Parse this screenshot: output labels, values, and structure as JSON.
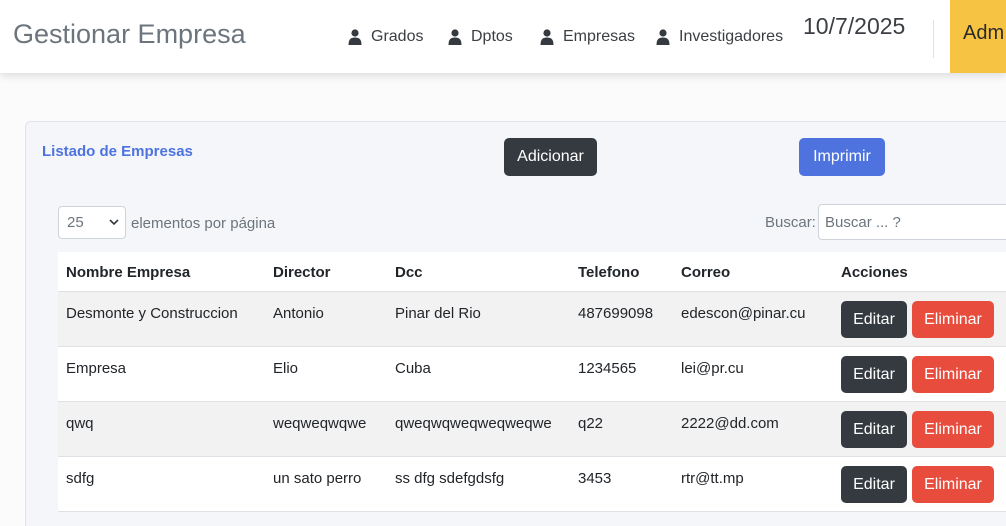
{
  "header": {
    "brand": "Gestionar Empresa",
    "nav": [
      {
        "label": "Grados",
        "icon": "user-icon"
      },
      {
        "label": "Dptos",
        "icon": "user-icon"
      },
      {
        "label": "Empresas",
        "icon": "user-icon"
      },
      {
        "label": "Investigadores",
        "icon": "user-icon"
      }
    ],
    "date": "10/7/2025",
    "admin_label": "Adm"
  },
  "card": {
    "title": "Listado de Empresas",
    "add_label": "Adicionar",
    "print_label": "Imprimir"
  },
  "controls": {
    "page_size": "25",
    "per_page_label": "elementos por página",
    "search_label": "Buscar:",
    "search_placeholder": "Buscar ... ?"
  },
  "table": {
    "headers": [
      "Nombre Empresa",
      "Director",
      "Dcc",
      "Telefono",
      "Correo",
      "Acciones"
    ],
    "rows": [
      [
        "Desmonte y Construccion",
        "Antonio",
        "Pinar del Rio",
        "487699098",
        "edescon@pinar.cu"
      ],
      [
        "Empresa",
        "Elio",
        "Cuba",
        "1234565",
        "lei@pr.cu"
      ],
      [
        "qwq",
        "weqweqwqwe",
        "qweqwqweqweqweqwe",
        "q22",
        "2222@dd.com"
      ],
      [
        "sdfg",
        "un sato perro",
        "ss dfg sdefgdsfg",
        "3453",
        "rtr@tt.mp"
      ]
    ],
    "edit_label": "Editar",
    "delete_label": "Eliminar"
  },
  "colors": {
    "accent": "#4e73df",
    "dark": "#343a40",
    "danger": "#e74c3c",
    "warning": "#f6c343"
  }
}
